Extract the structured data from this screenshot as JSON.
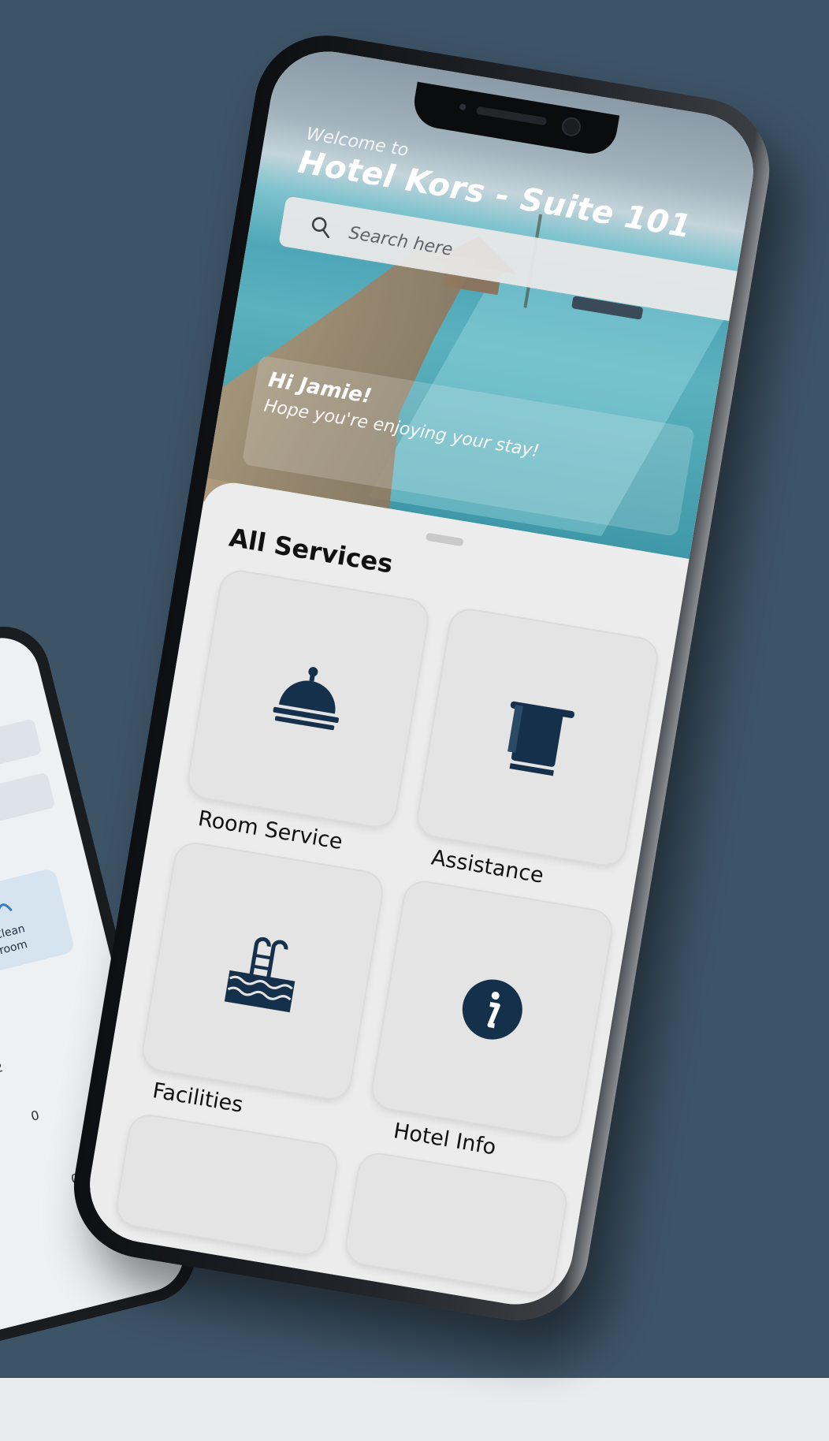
{
  "app": {
    "welcome_text": "Welcome to",
    "hotel_name": "Hotel Kors - Suite 101",
    "search_placeholder": "Search here",
    "greeting_title": "Hi Jamie!",
    "greeting_sub": "Hope you're enjoying your stay!",
    "section_title": "All Services",
    "services": [
      {
        "label": "Room Service",
        "icon": "service-bell-icon"
      },
      {
        "label": "Assistance",
        "icon": "towel-icon"
      },
      {
        "label": "Facilities",
        "icon": "pool-ladder-icon"
      },
      {
        "label": "Hotel Info",
        "icon": "info-icon"
      }
    ]
  },
  "background_phone": {
    "card_label_line1": "Clean",
    "card_label_line2": "room",
    "keypad_glyphs": [
      "2",
      "0",
      "0",
      "+"
    ]
  },
  "colors": {
    "backdrop": "#3d5366",
    "icon_navy": "#15304a",
    "sheet": "#ececec"
  }
}
